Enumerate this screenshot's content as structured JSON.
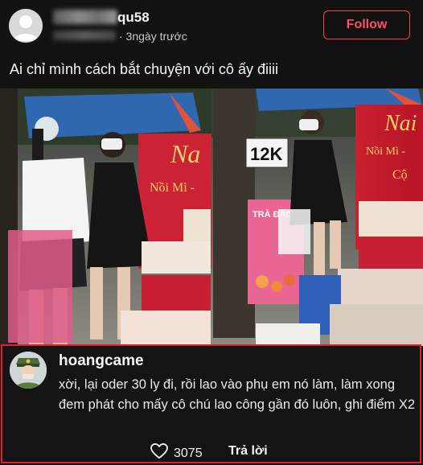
{
  "post": {
    "username_visible": "qu58",
    "meta": "· 3ngày trước",
    "follow_label": "Follow",
    "caption": "Ai chỉ mình cách bắt chuyện với cô ấy điiii",
    "photo": {
      "left_sign_text": "Na",
      "left_sign_sub": "Nồi Mì -",
      "right_sign_text": "Nai",
      "right_sign_sub": "Nồi Mì - ",
      "right_sign_sub2": "Cộ",
      "price_tag": "12K",
      "cart_label": "TRÀ ĐÀO"
    }
  },
  "comment": {
    "username": "hoangcame",
    "text": "xời, lại oder 30 ly đi, rồi lao vào phụ em nó làm, làm xong đem phát cho mấy cô chú lao công gần đó luôn, ghi điểm X2",
    "like_count": "3075",
    "reply_label": "Trả lời",
    "highlight_color": "#e0202a"
  },
  "icons": {
    "like": "heart-icon",
    "avatar": "default-avatar-icon",
    "comment_avatar": "police-avatar-icon"
  }
}
